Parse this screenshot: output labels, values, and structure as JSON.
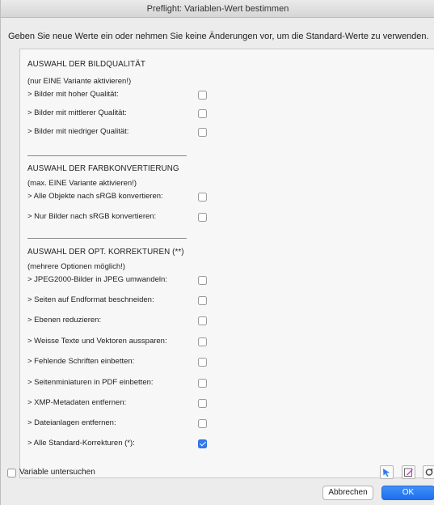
{
  "window": {
    "title": "Preflight: Variablen-Wert bestimmen"
  },
  "instruction": "Geben Sie neue Werte ein oder nehmen Sie keine Änderungen vor, um die Standard-Werte zu verwenden.",
  "sections": [
    {
      "heading": "AUSWAHL DER BILDQUALITÄT",
      "note": "(nur EINE Variante aktivieren!)",
      "options": [
        {
          "label": "> Bilder mit hoher Qualität:",
          "checked": false
        },
        {
          "label": "> Bilder mit mittlerer Qualität:",
          "checked": false
        },
        {
          "label": "> Bilder mit niedriger Qualität:",
          "checked": false
        }
      ]
    },
    {
      "heading": "AUSWAHL DER FARBKONVERTIERUNG",
      "note": "(max. EINE Variante aktivieren!)",
      "options": [
        {
          "label": "> Alle Objekte nach sRGB konvertieren:",
          "checked": false
        },
        {
          "label": "> Nur Bilder nach sRGB konvertieren:",
          "checked": false
        }
      ]
    },
    {
      "heading": "AUSWAHL DER OPT. KORREKTUREN (**)",
      "note": "(mehrere Optionen möglich!)",
      "options": [
        {
          "label": "> JPEG2000-Bilder in JPEG umwandeln:",
          "checked": false
        },
        {
          "label": "> Seiten auf Endformat beschneiden:",
          "checked": false
        },
        {
          "label": "> Ebenen reduzieren:",
          "checked": false
        },
        {
          "label": "> Weisse Texte und Vektoren aussparen:",
          "checked": false
        },
        {
          "label": "> Fehlende Schriften einbetten:",
          "checked": false
        },
        {
          "label": "> Seitenminiaturen in PDF einbetten:",
          "checked": false
        },
        {
          "label": "> XMP-Metadaten entfernen:",
          "checked": false
        },
        {
          "label": "> Dateianlagen entfernen:",
          "checked": false
        },
        {
          "label": "> Alle Standard-Korrekturen (*):",
          "checked": true
        }
      ]
    }
  ],
  "footer": {
    "inspect_variable_label": "Variable untersuchen",
    "inspect_variable_checked": false,
    "icons": [
      "select-arrow-icon",
      "edit-icon",
      "reset-icon"
    ],
    "cancel_label": "Abbrechen",
    "ok_label": "OK"
  },
  "colors": {
    "accent": "#2f7bf5",
    "window_bg": "#ececec",
    "panel_bg": "#f7f7f7"
  }
}
